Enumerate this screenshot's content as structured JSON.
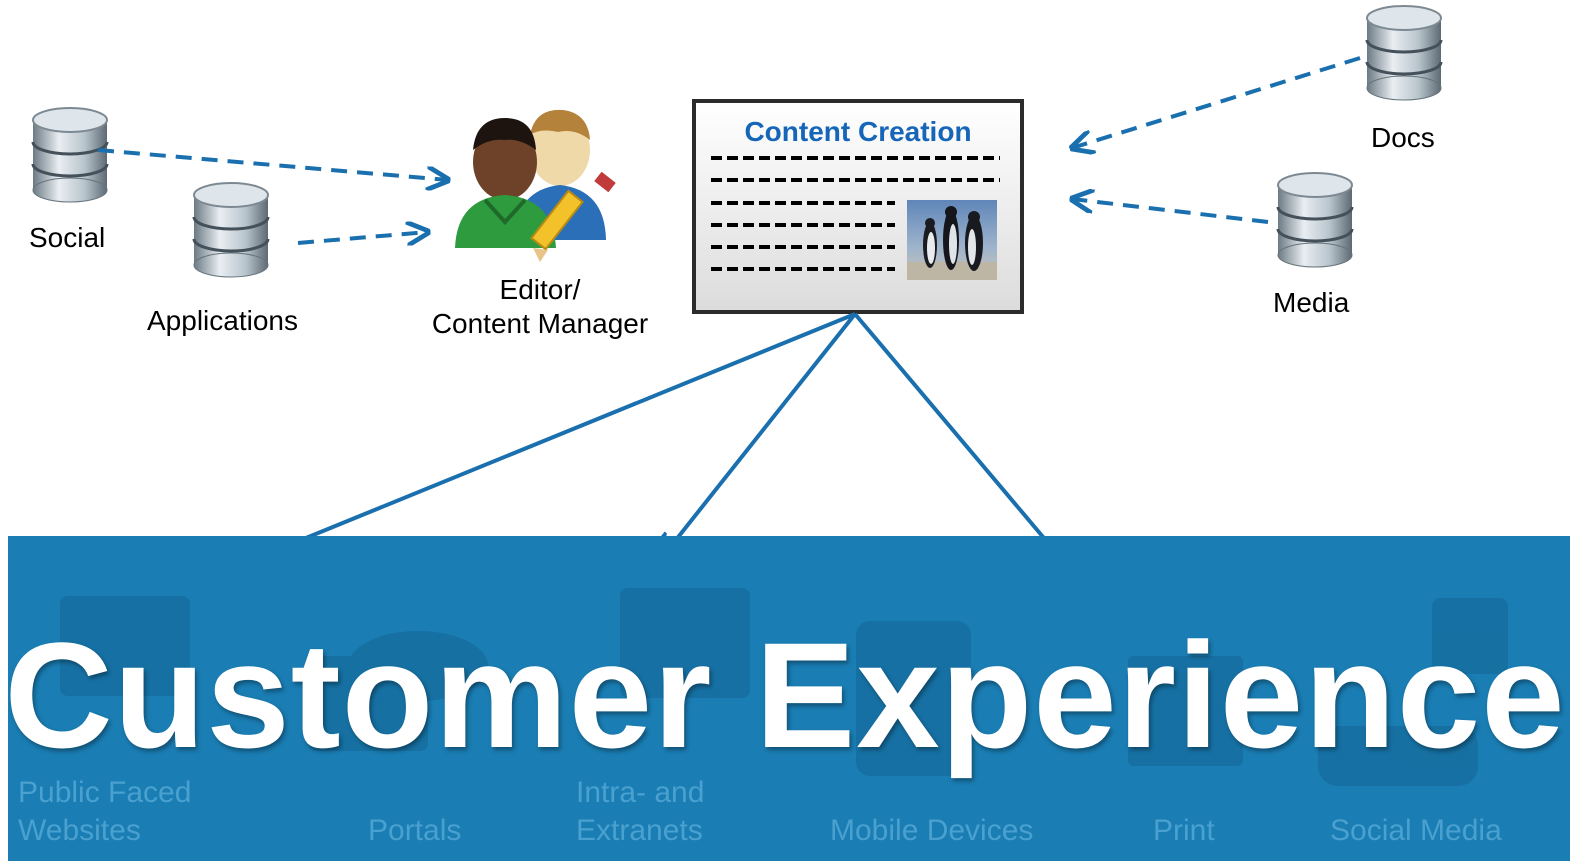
{
  "sources": {
    "social": "Social",
    "applications": "Applications",
    "docs": "Docs",
    "media": "Media"
  },
  "editor": {
    "line1": "Editor/",
    "line2": "Content Manager"
  },
  "content_creation": {
    "title": "Content Creation"
  },
  "banner": {
    "title": "Customer Experience",
    "channels": {
      "public_line1": "Public Faced",
      "public_line2": "Websites",
      "portals": "Portals",
      "intra_line1": "Intra- and",
      "intra_line2": "Extranets",
      "mobile": "Mobile Devices",
      "print": "Print",
      "social_media": "Social Media"
    }
  },
  "colors": {
    "arrow_blue": "#1a6fae",
    "banner": "#1a7db3",
    "title_blue": "#1565b8"
  },
  "icons": [
    "database-icon",
    "people-editor-icon",
    "penguins-image",
    "monitor-icon",
    "facebook-icon",
    "twitter-icon"
  ]
}
